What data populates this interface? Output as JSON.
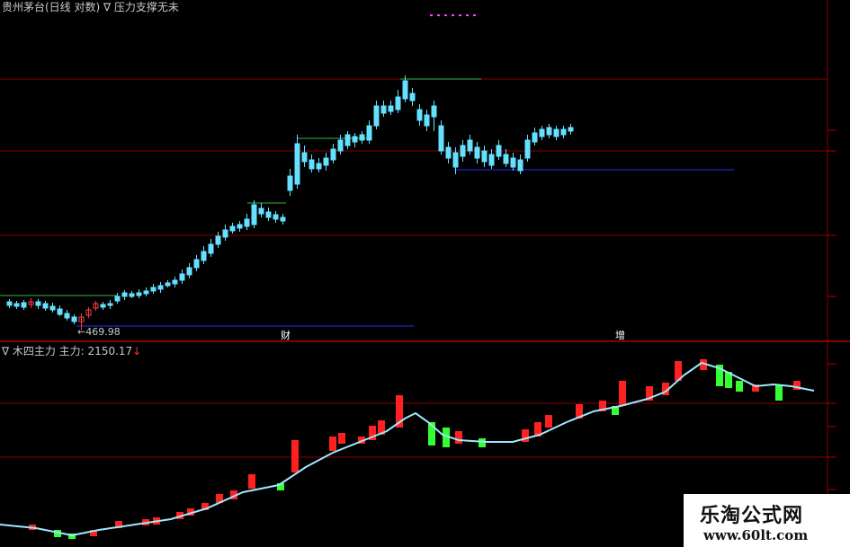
{
  "header": {
    "stock_title": "贵州茅台(日线 对数)",
    "indicator_title": "∇ 压力支撑无未"
  },
  "main_panel": {
    "low_label": "←469.98",
    "marker_1": "财",
    "marker_2": "增"
  },
  "sub_panel": {
    "indicator_name": "∇ 木四主力",
    "series_label": "主力:",
    "series_value": "2150.17",
    "arrow": "↓"
  },
  "watermark": {
    "name": "乐淘公式网",
    "url": "www.60lt.com"
  },
  "colors": {
    "background": "#000000",
    "grid": "#8b0000",
    "up_candle": "#ff3b3b",
    "down_candle": "#66e0ff",
    "resistance": "#3cb043",
    "support": "#2a2aff",
    "bar_up": "#ff2020",
    "bar_down": "#33ff33",
    "main_line": "#9fe8ff",
    "dots": "#ff44ff"
  },
  "icons": [
    "triangle-down-icon",
    "arrow-down-icon",
    "arrow-left-icon"
  ]
}
